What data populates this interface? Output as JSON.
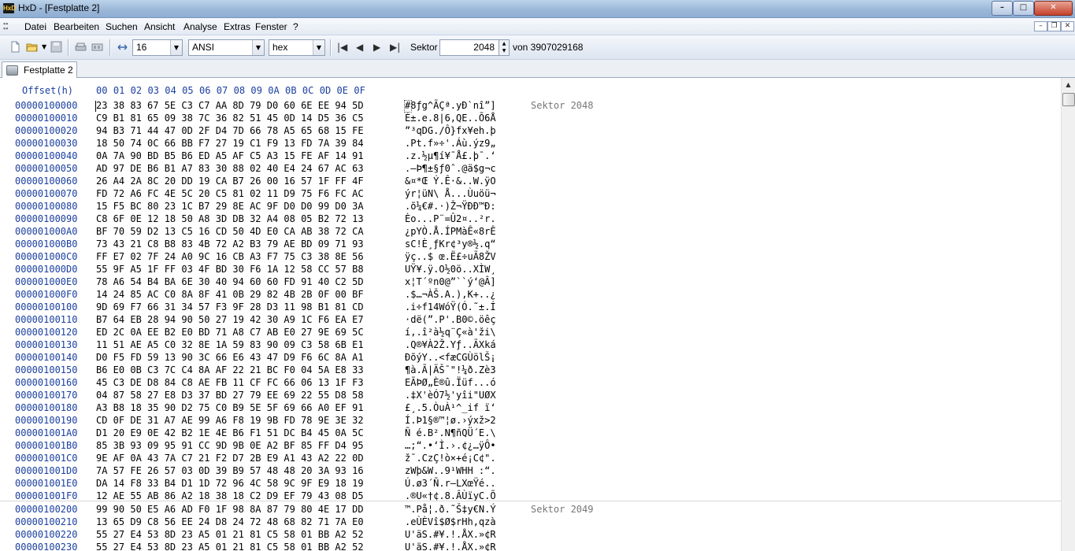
{
  "window": {
    "title": "HxD - [Festplatte 2]",
    "app_icon_text": "HxD"
  },
  "menu": [
    "Datei",
    "Bearbeiten",
    "Suchen",
    "Ansicht",
    "Analyse",
    "Extras",
    "Fenster",
    "?"
  ],
  "toolbar": {
    "bytes_per_row": "16",
    "charset": "ANSI",
    "offset_base": "hex",
    "sector_label": "Sektor",
    "sector_value": "2048",
    "sector_total": "von 3907029168"
  },
  "tab": {
    "label": "Festplatte 2"
  },
  "hex_header": {
    "offset": "Offset(h)",
    "columns": "00 01 02 03 04 05 06 07 08 09 0A 0B 0C 0D 0E 0F"
  },
  "rows": [
    {
      "offset": "00000100000",
      "hex": "23 38 83 67 5E C3 C7 AA 8D 79 D0 60 6E EE 94 5D",
      "text": "#8ƒg^ÃÇª.yÐ`nî”]",
      "sector": "Sektor 2048"
    },
    {
      "offset": "00000100010",
      "hex": "C9 B1 81 65 09 38 7C 36 82 51 45 0D 14 D5 36 C5",
      "text": "É±.e.8|6‚QE..Õ6Å"
    },
    {
      "offset": "00000100020",
      "hex": "94 B3 71 44 47 0D 2F D4 7D 66 78 A5 65 68 15 FE",
      "text": "”³qDG./Ô}fx¥eh.þ"
    },
    {
      "offset": "00000100030",
      "hex": "18 50 74 0C 66 BB F7 27 19 C1 F9 13 FD 7A 39 84",
      "text": ".Pt.f»÷'.Áù.ýz9„"
    },
    {
      "offset": "00000100040",
      "hex": "0A 7A 90 BD B5 B6 ED A5 AF C5 A3 15 FE AF 14 91",
      "text": ".z.½µ¶í¥¯Å£.þ¯.‘"
    },
    {
      "offset": "00000100050",
      "hex": "AD 97 DE B6 B1 A7 83 30 88 02 40 E4 24 67 AC 63",
      "text": ".—Þ¶±§ƒ0ˆ.@ä$g¬c"
    },
    {
      "offset": "00000100060",
      "hex": "26 A4 2A 8C 20 DD 19 CA B7 26 00 16 57 1F FF 4F",
      "text": "&¤*Œ Ý.Ê·&..W.ÿO"
    },
    {
      "offset": "00000100070",
      "hex": "FD 72 A6 FC 4E 5C 20 C5 81 02 11 D9 75 F6 FC AC",
      "text": "ýr¦üN\\ Å...Ùuöü¬"
    },
    {
      "offset": "00000100080",
      "hex": "15 F5 BC 80 23 1C B7 29 8E AC 9F D0 D0 99 D0 3A",
      "text": ".õ¼€#.·)Ž¬ŸÐÐ™Ð:"
    },
    {
      "offset": "00000100090",
      "hex": "C8 6F 0E 12 18 50 A8 3D DB 32 A4 08 05 B2 72 13",
      "text": "Èo...P¨=Û2¤..²r."
    },
    {
      "offset": "000001000A0",
      "hex": "BF 70 59 D2 13 C5 16 CD 50 4D E0 CA AB 38 72 CA",
      "text": "¿pYÒ.Å.ÍPMàÊ«8rÊ"
    },
    {
      "offset": "000001000B0",
      "hex": "73 43 21 C8 B8 83 4B 72 A2 B3 79 AE BD 09 71 93",
      "text": "sC!È¸ƒKr¢³y®½.q“"
    },
    {
      "offset": "000001000C0",
      "hex": "FF E7 02 7F 24 A0 9C 16 CB A3 F7 75 C3 38 8E 56",
      "text": "ÿç..$ œ.Ë£÷uÃ8ŽV"
    },
    {
      "offset": "000001000D0",
      "hex": "55 9F A5 1F FF 03 4F BD 30 F6 1A 12 58 CC 57 B8",
      "text": "UŸ¥.ÿ.O½0ö..XÌW¸"
    },
    {
      "offset": "000001000E0",
      "hex": "78 A6 54 B4 BA 6E 30 40 94 60 60 FD 91 40 C2 5D",
      "text": "x¦T´ºn0@”``ý‘@Â]"
    },
    {
      "offset": "000001000F0",
      "hex": "14 24 85 AC C0 8A 8F 41 0B 29 82 4B 2B 0F 00 BF",
      "text": ".$…¬ÀŠ.A.)‚K+..¿"
    },
    {
      "offset": "00000100100",
      "hex": "9D 69 F7 66 31 34 57 F3 9F 28 D3 11 98 B1 81 CD",
      "text": ".i÷f14WóŸ(Ó.˜±.Í"
    },
    {
      "offset": "00000100110",
      "hex": "B7 64 EB 28 94 90 50 27 19 42 30 A9 1C F6 EA E7",
      "text": "·dë(”.P'.B0©.öêç"
    },
    {
      "offset": "00000100120",
      "hex": "ED 2C 0A EE B2 E0 BD 71 A8 C7 AB E0 27 9E 69 5C",
      "text": "í,.î²à½q¨Ç«à'ži\\"
    },
    {
      "offset": "00000100130",
      "hex": "11 51 AE A5 C0 32 8E 1A 59 83 90 09 C3 58 6B E1",
      "text": ".Q®¥À2Ž.Yƒ..ÃXká"
    },
    {
      "offset": "00000100140",
      "hex": "D0 F5 FD 59 13 90 3C 66 E6 43 47 D9 F6 6C 8A A1",
      "text": "ÐõýY..<fæCGÙölŠ¡"
    },
    {
      "offset": "00000100150",
      "hex": "B6 E0 0B C3 7C C4 8A AF 22 21 BC F0 04 5A E8 33",
      "text": "¶à.Ã|ÄŠ¯\"!¼ð.Zè3"
    },
    {
      "offset": "00000100160",
      "hex": "45 C3 DE D8 84 C8 AE FB 11 CF FC 66 06 13 1F F3",
      "text": "EÃÞØ„È®û.Ïüf...ó"
    },
    {
      "offset": "00000100170",
      "hex": "04 87 58 27 E8 D3 37 BD 27 79 EE 69 22 55 D8 58",
      "text": ".‡X'èÓ7½'yîi\"UØX"
    },
    {
      "offset": "00000100180",
      "hex": "A3 B8 18 35 90 D2 75 C0 B9 5E 5F 69 66 A0 EF 91",
      "text": "£¸.5.ÒuÀ¹^_if ï‘"
    },
    {
      "offset": "00000100190",
      "hex": "CD 0F DE 31 A7 AE 99 A6 F8 19 9B FD 78 9E 3E 32",
      "text": "Í.Þ1§®™¦ø.›ýxž>2"
    },
    {
      "offset": "000001001A0",
      "hex": "D1 20 E9 0E 42 B2 1E 4E B6 F1 51 DC B4 45 0A 5C",
      "text": "Ñ é.B².N¶ñQÜ´E.\\"
    },
    {
      "offset": "000001001B0",
      "hex": "85 3B 93 09 95 91 CC 9D 9B 0E A2 BF 85 FF D4 95",
      "text": "…;“.•‘Ì.›.¢¿…ÿÔ•"
    },
    {
      "offset": "000001001C0",
      "hex": "9E AF 0A 43 7A C7 21 F2 D7 2B E9 A1 43 A2 22 0D",
      "text": "ž¯.CzÇ!ò×+é¡C¢\"."
    },
    {
      "offset": "000001001D0",
      "hex": "7A 57 FE 26 57 03 0D 39 B9 57 48 48 20 3A 93 16",
      "text": "zWþ&W..9¹WHH :“."
    },
    {
      "offset": "000001001E0",
      "hex": "DA 14 F8 33 B4 D1 1D 72 96 4C 58 9C 9F E9 18 19",
      "text": "Ú.ø3´Ñ.r–LXœŸé.."
    },
    {
      "offset": "000001001F0",
      "hex": "12 AE 55 AB 86 A2 18 38 18 C2 D9 EF 79 43 08 D5",
      "text": ".®U«†¢.8.ÂÙïyC.Õ"
    },
    {
      "offset": "00000100200",
      "hex": "99 90 50 E5 A6 AD F0 1F 98 8A 87 79 80 4E 17 DD",
      "text": "™.På¦.ð.˜Š‡y€N.Ý",
      "sector": "Sektor 2049"
    },
    {
      "offset": "00000100210",
      "hex": "13 65 D9 C8 56 EE 24 D8 24 72 48 68 82 71 7A E0",
      "text": ".eÙÈVî$Ø$rHh‚qzà"
    },
    {
      "offset": "00000100220",
      "hex": "55 27 E4 53 8D 23 A5 01 21 81 C5 58 01 BB A2 52",
      "text": "U'äS.#¥.!.ÅX.»¢R"
    },
    {
      "offset": "00000100230",
      "hex": "55 27 E4 53 8D 23 A5 01 21 81 C5 58 01 BB A2 52",
      "text": "U'äS.#¥.!.ÅX.»¢R"
    }
  ]
}
